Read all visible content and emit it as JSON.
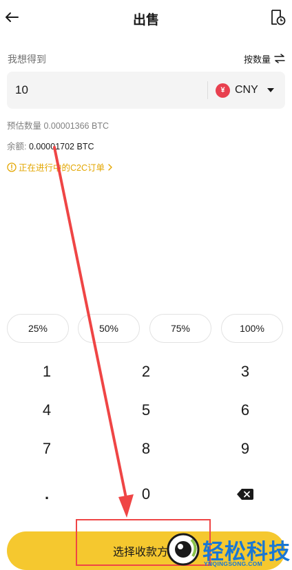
{
  "header": {
    "title": "出售",
    "back_icon": "arrow-left-icon",
    "history_icon": "order-history-icon"
  },
  "form": {
    "receive_label": "我想得到",
    "switch_label": "按数量",
    "switch_icon": "swap-arrows-icon",
    "amount_value": "10",
    "currency_symbol": "¥",
    "currency_code": "CNY",
    "estimate_text": "预估数量 0.00001366 BTC",
    "balance_label": "余额:",
    "balance_value": "0.00001702 BTC",
    "c2c_link": "正在进行中的C2C订单"
  },
  "percent_chips": [
    "25%",
    "50%",
    "75%",
    "100%"
  ],
  "keypad": {
    "rows": [
      [
        "1",
        "2",
        "3"
      ],
      [
        "4",
        "5",
        "6"
      ],
      [
        "7",
        "8",
        "9"
      ],
      [
        ".",
        "0",
        ""
      ]
    ],
    "delete_icon": "backspace-icon"
  },
  "cta": {
    "label": "选择收款方式"
  },
  "watermark": {
    "name": "轻松科技",
    "domain": "YNQINGSONG.COM"
  },
  "colors": {
    "accent_yellow": "#f5c82f",
    "warning_text": "#e3a600",
    "cny_badge": "#e8404f",
    "annotation_red": "#ef4545",
    "watermark_blue": "#1977d4"
  }
}
